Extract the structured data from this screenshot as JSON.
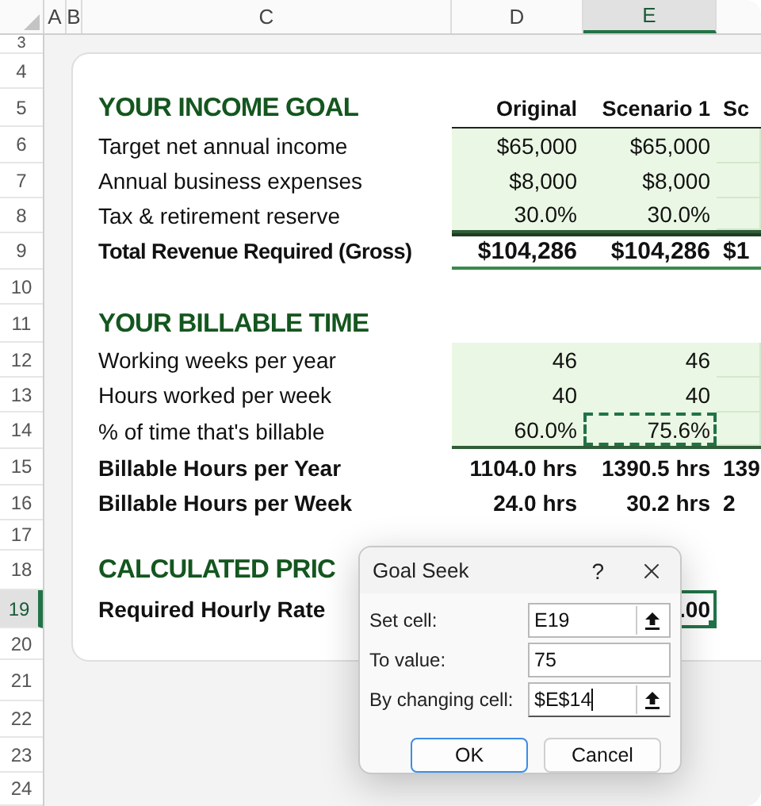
{
  "column_headers": [
    {
      "label": "A",
      "selected": false
    },
    {
      "label": "B",
      "selected": false
    },
    {
      "label": "C",
      "selected": false
    },
    {
      "label": "D",
      "selected": false
    },
    {
      "label": "E",
      "selected": true
    }
  ],
  "row_headers": [
    {
      "label": "3",
      "selected": false
    },
    {
      "label": "4",
      "selected": false
    },
    {
      "label": "5",
      "selected": false
    },
    {
      "label": "6",
      "selected": false
    },
    {
      "label": "7",
      "selected": false
    },
    {
      "label": "8",
      "selected": false
    },
    {
      "label": "9",
      "selected": false
    },
    {
      "label": "10",
      "selected": false
    },
    {
      "label": "11",
      "selected": false
    },
    {
      "label": "12",
      "selected": false
    },
    {
      "label": "13",
      "selected": false
    },
    {
      "label": "14",
      "selected": false
    },
    {
      "label": "15",
      "selected": false
    },
    {
      "label": "16",
      "selected": false
    },
    {
      "label": "17",
      "selected": false
    },
    {
      "label": "18",
      "selected": false
    },
    {
      "label": "19",
      "selected": true
    },
    {
      "label": "20",
      "selected": false
    },
    {
      "label": "21",
      "selected": false
    },
    {
      "label": "22",
      "selected": false
    },
    {
      "label": "23",
      "selected": false
    },
    {
      "label": "24",
      "selected": false
    }
  ],
  "sheet_rows": [
    {
      "kind": "blank"
    },
    {
      "kind": "heading",
      "label": "YOUR INCOME GOAL",
      "values": [
        {
          "text": "Original",
          "selected": false
        },
        {
          "text": "Scenario 1",
          "selected": false
        },
        {
          "text": "Sc",
          "selected": false
        }
      ]
    },
    {
      "kind": "input",
      "label": "Target net annual income",
      "values": [
        {
          "text": "$65,000",
          "selected": false
        },
        {
          "text": "$65,000",
          "selected": false
        }
      ]
    },
    {
      "kind": "input",
      "label": "Annual business expenses",
      "values": [
        {
          "text": "$8,000",
          "selected": false
        },
        {
          "text": "$8,000",
          "selected": false
        }
      ]
    },
    {
      "kind": "input",
      "label": "Tax & retirement reserve",
      "values": [
        {
          "text": "30.0%",
          "selected": false
        },
        {
          "text": "30.0%",
          "selected": false
        }
      ]
    },
    {
      "kind": "total",
      "label": "Total Revenue Required (Gross)",
      "values": [
        {
          "text": "$104,286",
          "selected": false
        },
        {
          "text": "$104,286",
          "selected": false
        },
        {
          "text": "$1",
          "selected": false
        }
      ]
    },
    {
      "kind": "blank"
    },
    {
      "kind": "heading",
      "label": "YOUR BILLABLE TIME"
    },
    {
      "kind": "input",
      "label": "Working weeks per year",
      "values": [
        {
          "text": "46",
          "selected": false
        },
        {
          "text": "46",
          "selected": false
        }
      ]
    },
    {
      "kind": "input",
      "label": "Hours worked per week",
      "values": [
        {
          "text": "40",
          "selected": false
        },
        {
          "text": "40",
          "selected": false
        }
      ]
    },
    {
      "kind": "input",
      "label": "% of time that's billable",
      "values": [
        {
          "text": "60.0%",
          "selected": false,
          "marquee": false
        },
        {
          "text": "75.6%",
          "selected": false,
          "marquee": true
        }
      ]
    },
    {
      "kind": "subtotal",
      "label": "Billable Hours per Year",
      "values": [
        {
          "text": "1104.0 hrs",
          "selected": false
        },
        {
          "text": "1390.5 hrs",
          "selected": false
        },
        {
          "text": "139",
          "selected": false
        }
      ]
    },
    {
      "kind": "subtotal",
      "label": "Billable Hours per Week",
      "values": [
        {
          "text": "24.0 hrs",
          "selected": false
        },
        {
          "text": "30.2 hrs",
          "selected": false
        },
        {
          "text": "2",
          "selected": false
        }
      ]
    },
    {
      "kind": "blank"
    },
    {
      "kind": "heading",
      "label": "CALCULATED PRIC"
    },
    {
      "kind": "result",
      "label": "Required Hourly Rate",
      "values": [
        {
          "text": ".00",
          "selected": true
        }
      ]
    },
    {
      "kind": "blank"
    }
  ],
  "dialog": {
    "title": "Goal Seek",
    "help": "?",
    "fields": [
      {
        "label": "Set cell:",
        "value": "E19",
        "kind": "reference",
        "focused": false
      },
      {
        "label": "To value:",
        "value": "75",
        "kind": "plain",
        "focused": false
      },
      {
        "label": "By changing cell:",
        "value": "$E$14",
        "kind": "reference",
        "focused": true
      }
    ],
    "buttons": [
      {
        "label": "OK",
        "default": true
      },
      {
        "label": "Cancel",
        "default": false
      }
    ]
  }
}
